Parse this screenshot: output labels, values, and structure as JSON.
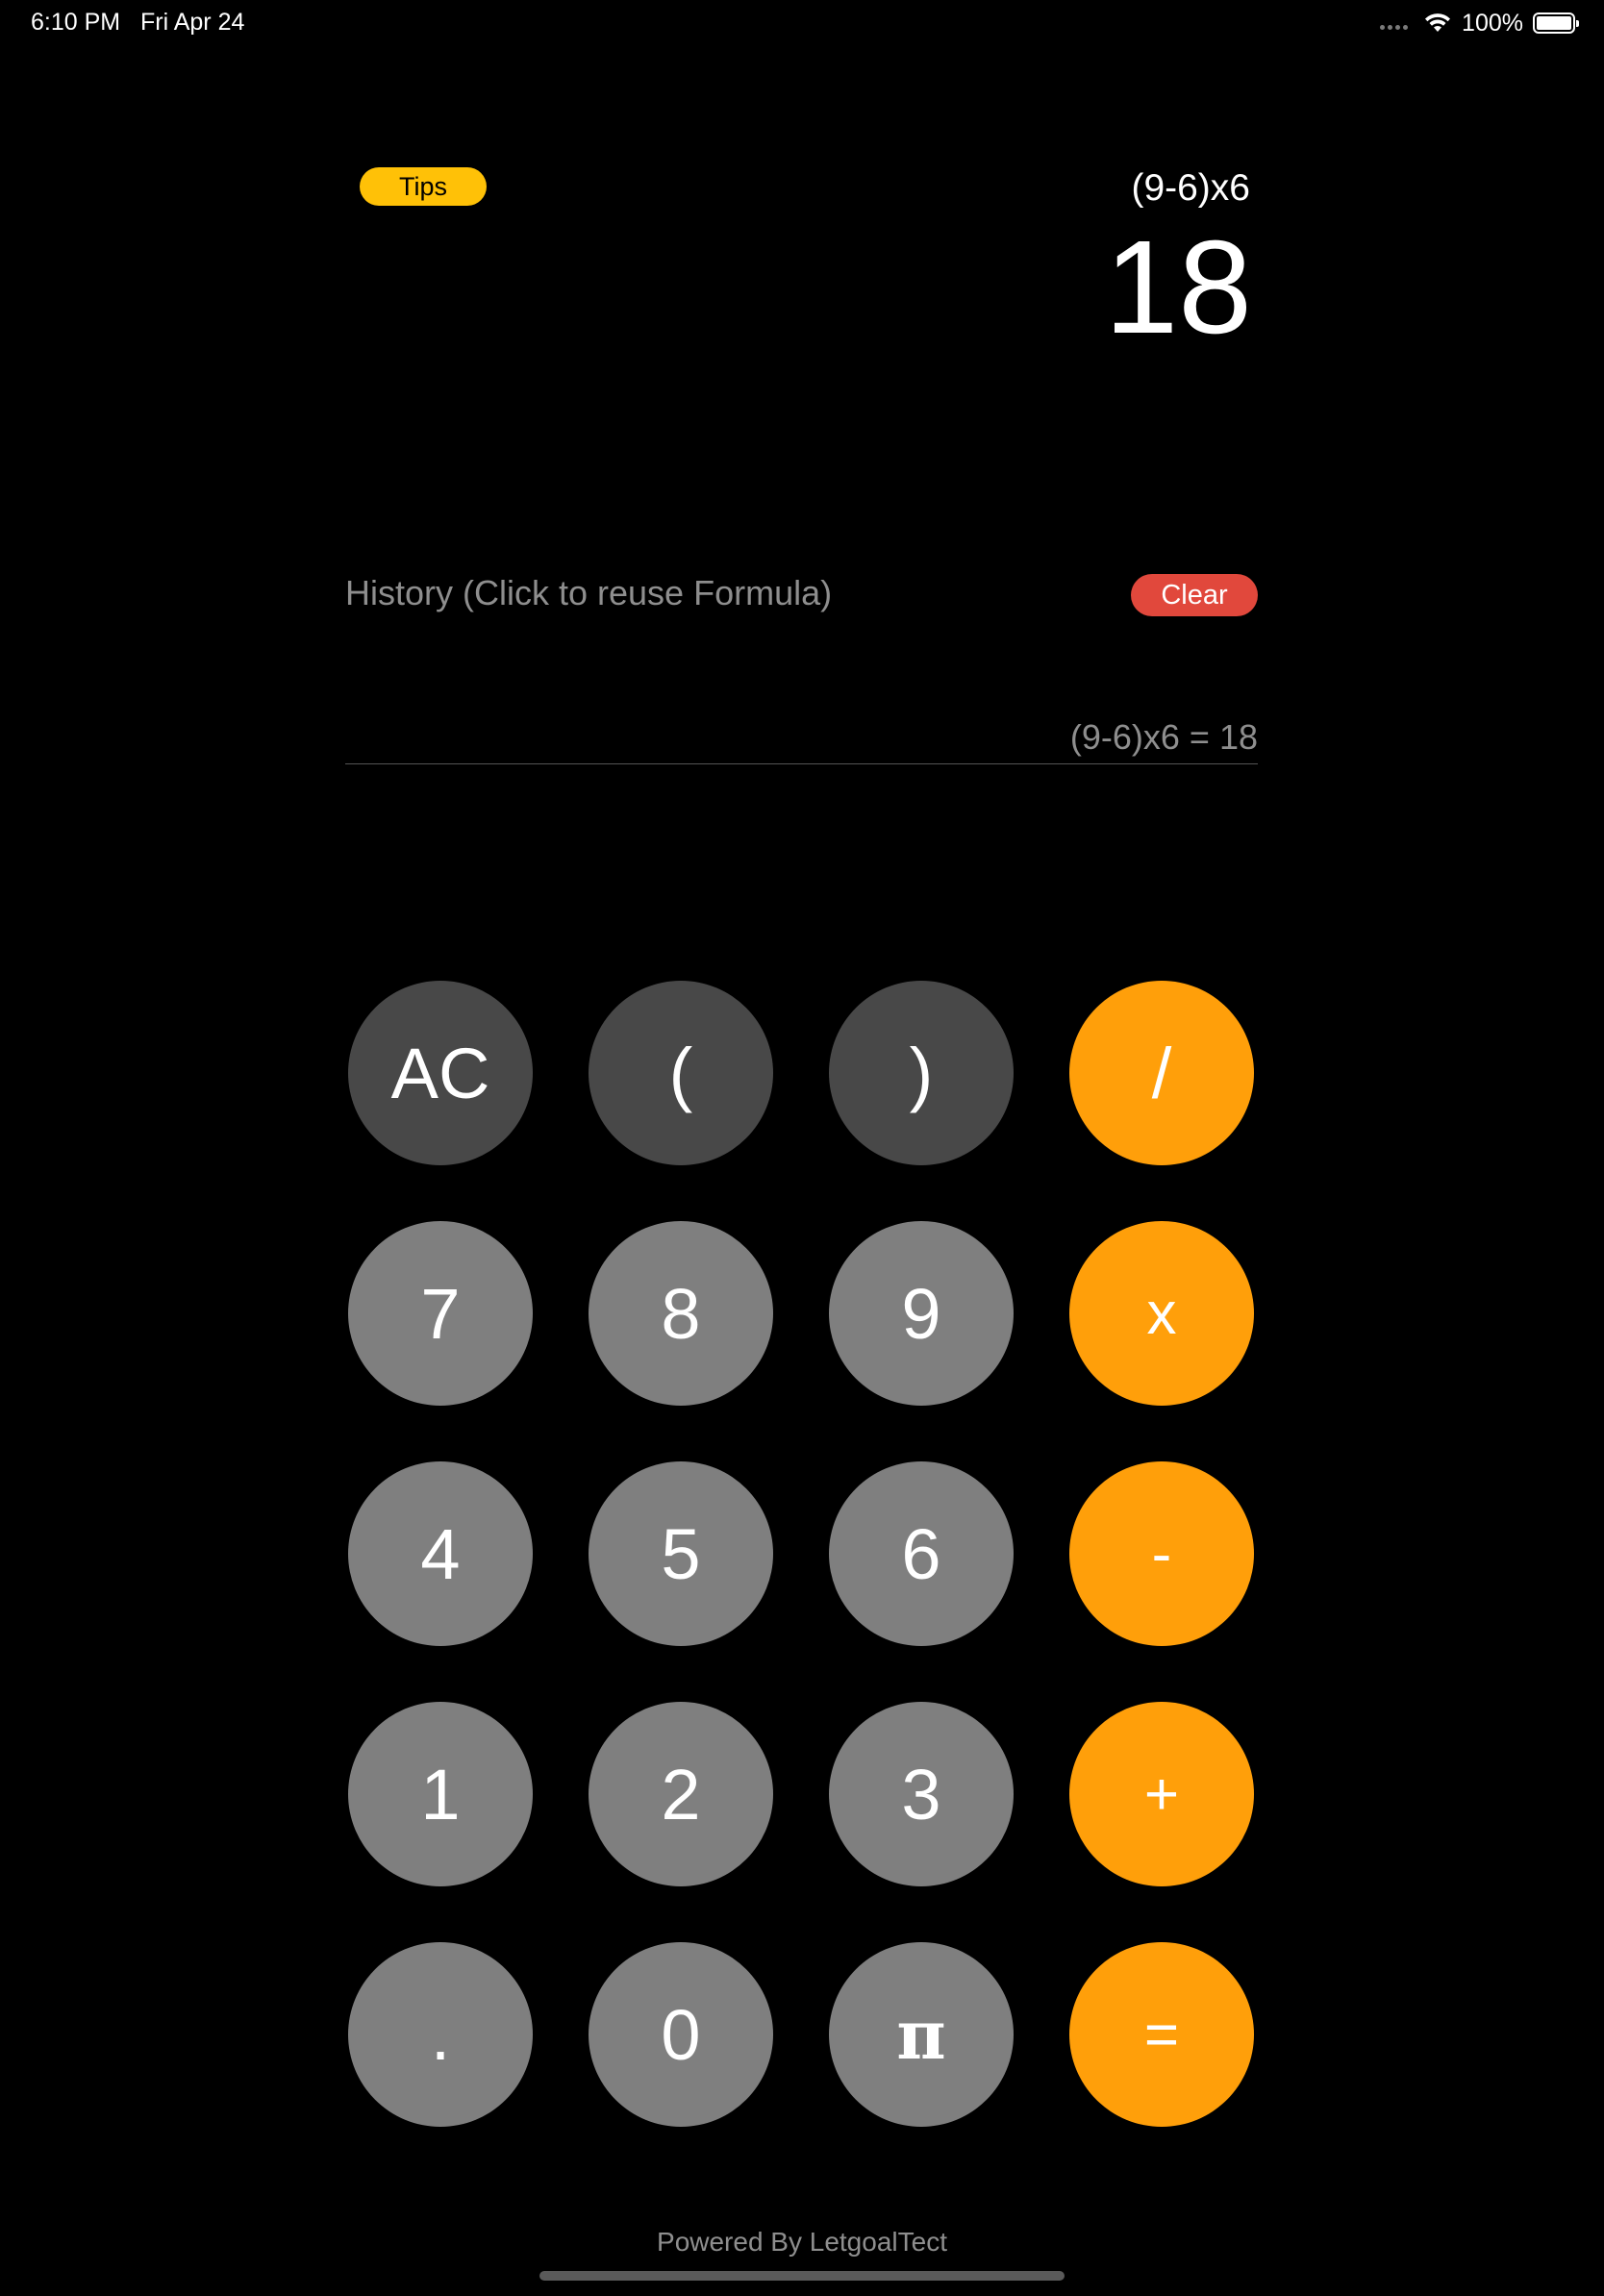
{
  "status_bar": {
    "time": "6:10 PM",
    "date": "Fri Apr 24",
    "battery_pct": "100%",
    "battery_level": 1.0
  },
  "display": {
    "tips_label": "Tips",
    "expression": "(9-6)x6",
    "result": "18"
  },
  "history": {
    "title": "History (Click to reuse Formula)",
    "clear_label": "Clear",
    "items": [
      "(9-6)x6  = 18"
    ]
  },
  "keypad": {
    "rows": [
      [
        "AC",
        "(",
        ")",
        "/"
      ],
      [
        "7",
        "8",
        "9",
        "x"
      ],
      [
        "4",
        "5",
        "6",
        "-"
      ],
      [
        "1",
        "2",
        "3",
        "+"
      ],
      [
        ".",
        "0",
        "π",
        "="
      ]
    ]
  },
  "footer": {
    "text": "Powered By LetgoalTect"
  },
  "colors": {
    "background": "#000000",
    "function_key": "#484848",
    "number_key": "#7f7f7f",
    "operator_key": "#ff9f0a",
    "tips_button": "#ffc107",
    "clear_button": "#e1483c",
    "muted_text": "#8e8e8e"
  }
}
